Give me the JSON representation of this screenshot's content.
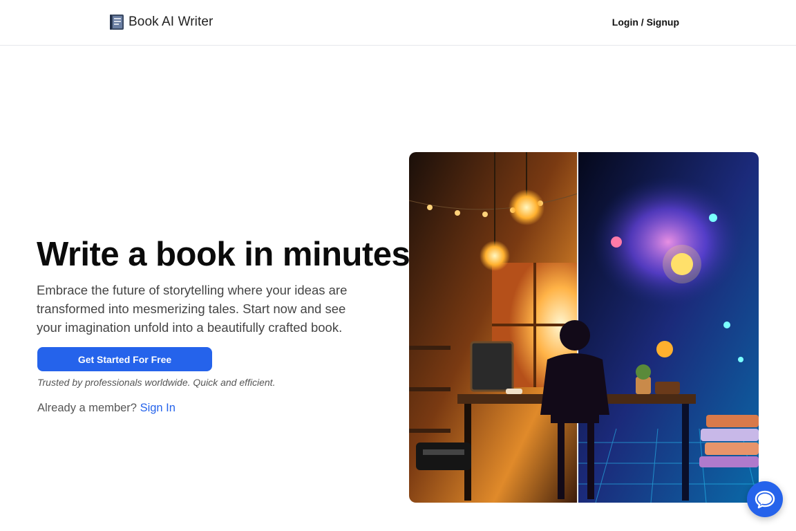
{
  "header": {
    "brand_name": "Book AI Writer",
    "brand_icon": "book-logo-icon",
    "login_label": "Login / Signup"
  },
  "hero": {
    "title": "Write a book in minutes.",
    "description": "Embrace the future of storytelling where your ideas are transformed into mesmerizing tales. Start now and see your imagination unfold into a beautifully crafted book.",
    "cta_label": "Get Started For Free",
    "trusted_text": "Trusted by professionals worldwide. Quick and efficient.",
    "member_prompt": "Already a member?",
    "sign_in_label": "Sign In",
    "image_icon": "writer-illustration"
  },
  "chat": {
    "icon": "chat-bubble-icon"
  },
  "colors": {
    "accent": "#2563eb",
    "text_dark": "#0b0b0b",
    "text_muted": "#444444"
  }
}
